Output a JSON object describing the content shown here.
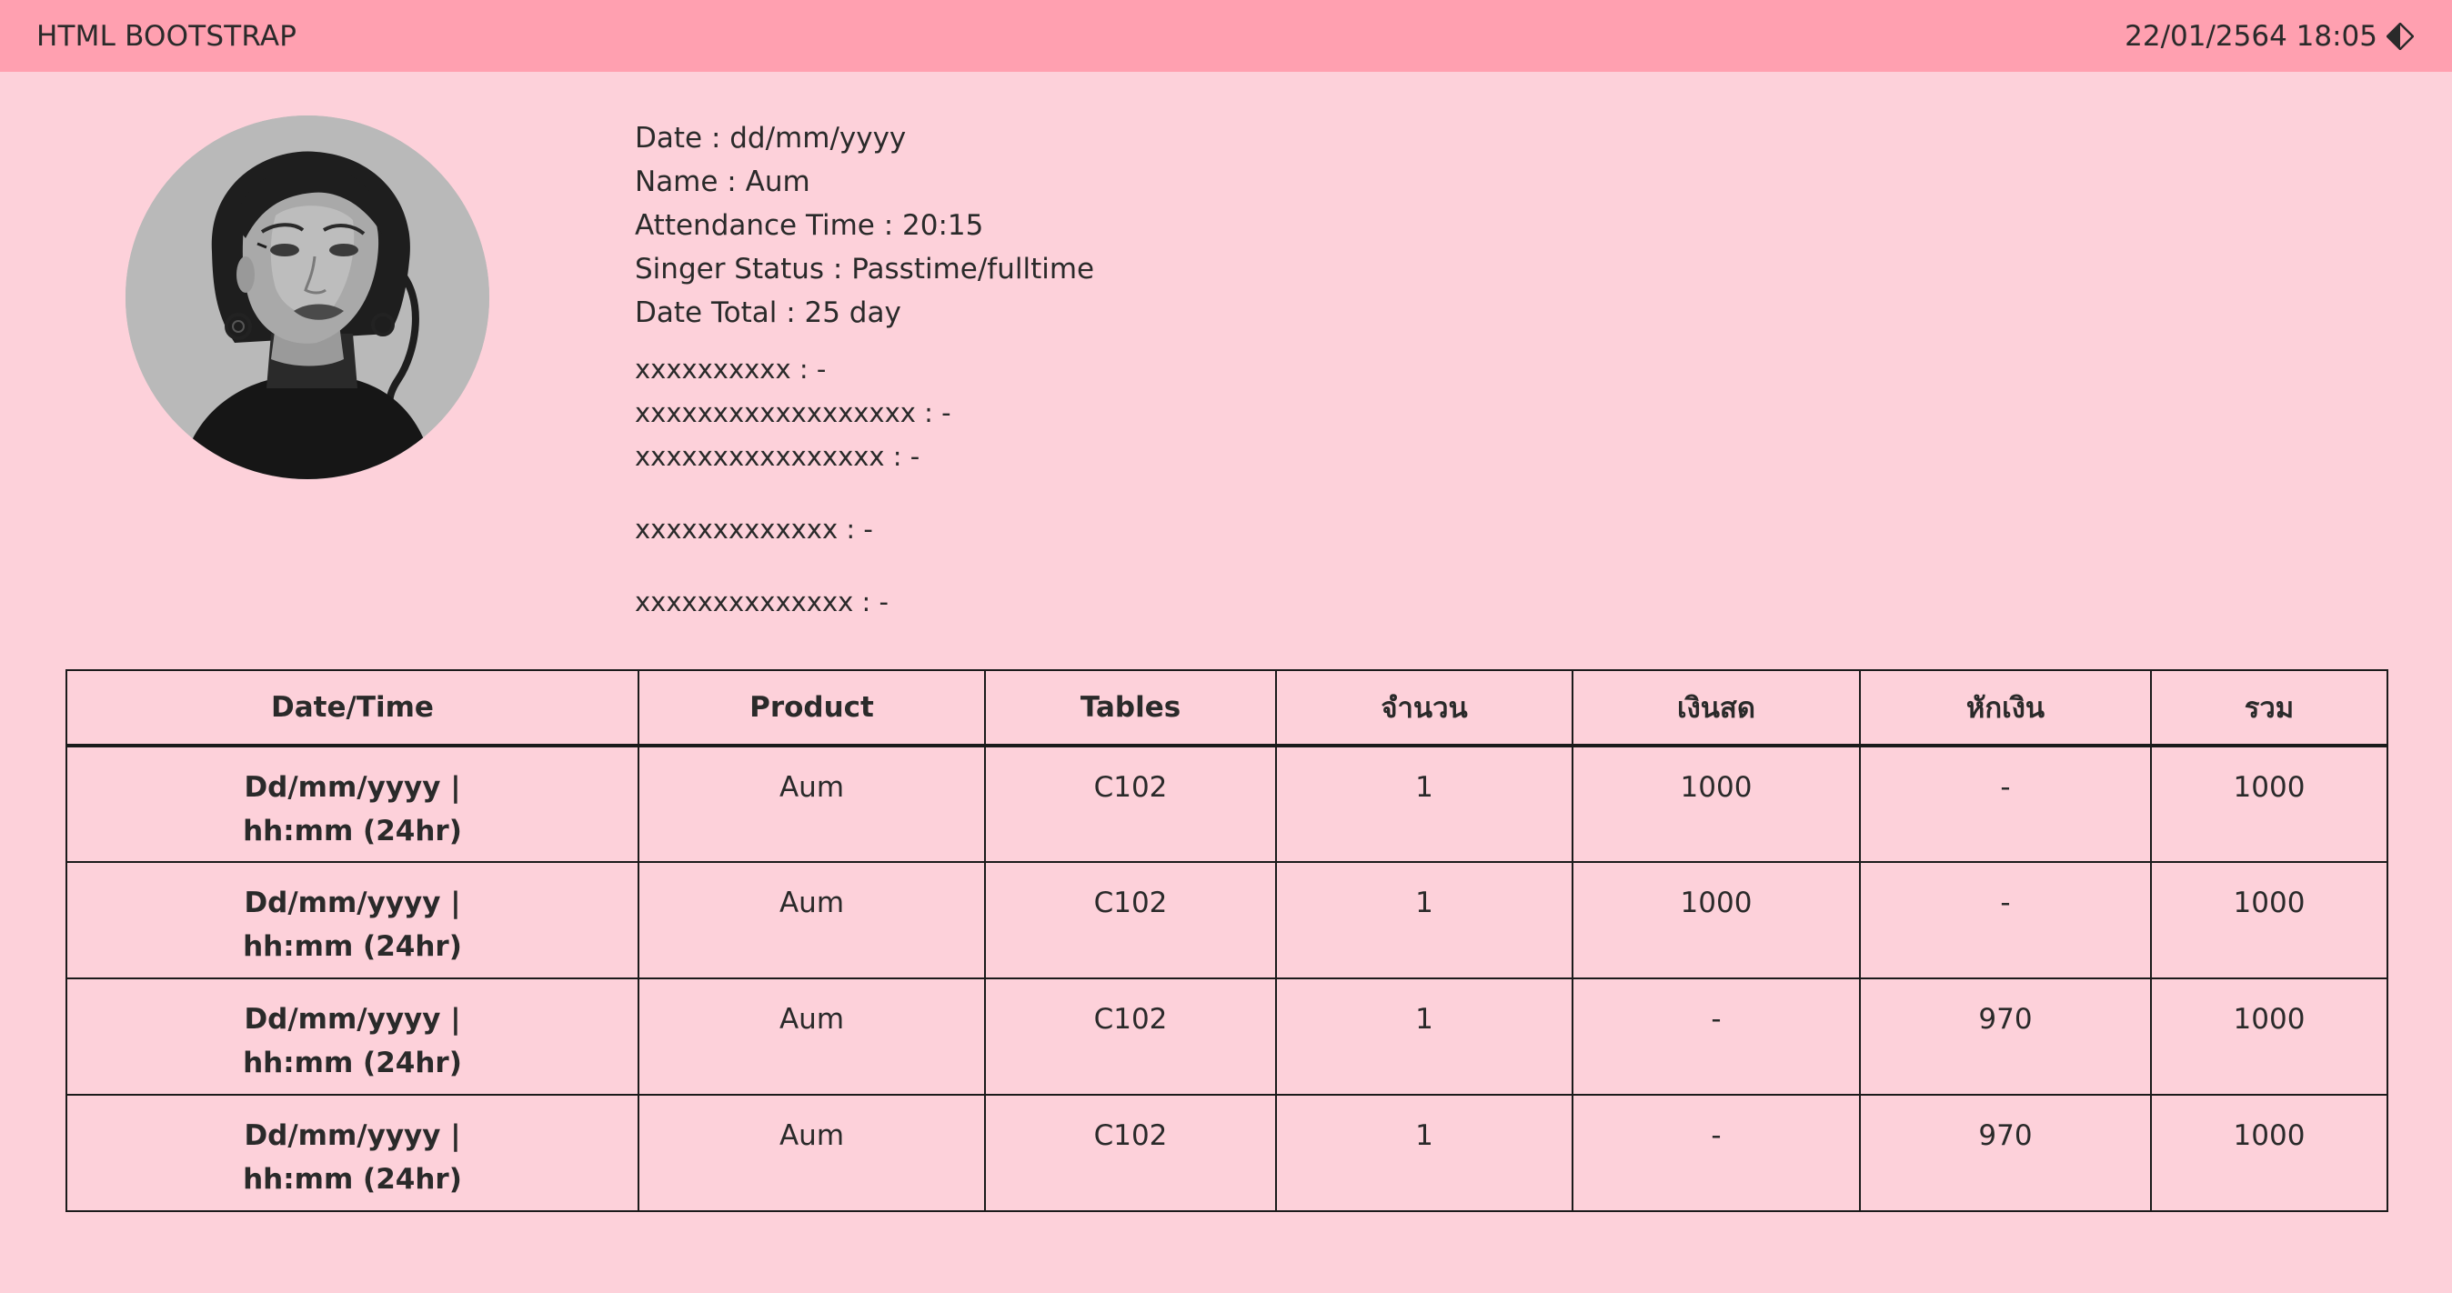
{
  "header": {
    "brand": "HTML BOOTSTRAP",
    "datetime": "22/01/2564 18:05",
    "theme_icon": "circle-half-icon"
  },
  "profile": {
    "avatar": "portrait-illustration",
    "lines": [
      "Date : dd/mm/yyyy",
      "Name : Aum",
      "Attendance Time : 20:15",
      "Singer Status : Passtime/fulltime",
      "Date Total : 25 day"
    ],
    "extra_group_1": [
      "xxxxxxxxxx : -",
      "xxxxxxxxxxxxxxxxxx : -",
      "xxxxxxxxxxxxxxxx : -"
    ],
    "extra_group_2": "xxxxxxxxxxxxx : -",
    "extra_group_3": "xxxxxxxxxxxxxx : -"
  },
  "table": {
    "columns": [
      "Date/Time",
      "Product",
      "Tables",
      "จำนวน",
      "เงินสด",
      "หักเงิน",
      "รวม"
    ],
    "rows": [
      {
        "datetime_1": "Dd/mm/yyyy |",
        "datetime_2": "hh:mm (24hr)",
        "product": "Aum",
        "tables": "C102",
        "qty": "1",
        "cash": "1000",
        "deduct": "-",
        "total": "1000"
      },
      {
        "datetime_1": "Dd/mm/yyyy |",
        "datetime_2": "hh:mm (24hr)",
        "product": "Aum",
        "tables": "C102",
        "qty": "1",
        "cash": "1000",
        "deduct": "-",
        "total": "1000"
      },
      {
        "datetime_1": "Dd/mm/yyyy |",
        "datetime_2": "hh:mm (24hr)",
        "product": "Aum",
        "tables": "C102",
        "qty": "1",
        "cash": "-",
        "deduct": "970",
        "total": "1000"
      },
      {
        "datetime_1": "Dd/mm/yyyy |",
        "datetime_2": "hh:mm (24hr)",
        "product": "Aum",
        "tables": "C102",
        "qty": "1",
        "cash": "-",
        "deduct": "970",
        "total": "1000"
      }
    ]
  },
  "colors": {
    "navbar": "#ffa0b0",
    "background": "#fdd1da",
    "border": "#1b1b1b"
  }
}
